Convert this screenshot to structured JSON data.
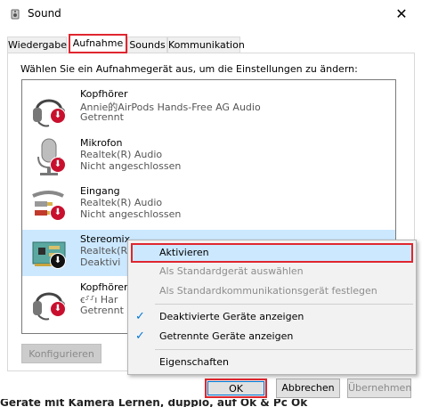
{
  "window": {
    "title": "Sound"
  },
  "tabs": [
    {
      "label": "Wiedergabe"
    },
    {
      "label": "Aufnahme"
    },
    {
      "label": "Sounds"
    },
    {
      "label": "Kommunikation"
    }
  ],
  "instruction": "Wählen Sie ein Aufnahmegerät aus, um die Einstellungen zu ändern:",
  "devices": [
    {
      "name": "Kopfhörer",
      "desc": "Annie的AirPods Hands-Free AG Audio",
      "state": "Getrennt",
      "icon": "headset-icon"
    },
    {
      "name": "Mikrofon",
      "desc": "Realtek(R) Audio",
      "state": "Nicht angeschlossen",
      "icon": "microphone-icon"
    },
    {
      "name": "Eingang",
      "desc": "Realtek(R) Audio",
      "state": "Nicht angeschlossen",
      "icon": "line-in-cable-icon"
    },
    {
      "name": "Stereomix",
      "desc": "Realtek(R)",
      "state": "Deaktivi",
      "icon": "circuit-board-icon"
    },
    {
      "name": "Kopfhörer",
      "desc": "ꞓ⸉⸉ı Har",
      "state": "Getrennt",
      "icon": "headset-icon"
    }
  ],
  "buttons": {
    "configure": "Konfigurieren",
    "ok": "OK",
    "cancel": "Abbrechen",
    "apply": "Übernehmen"
  },
  "context_menu": {
    "items": [
      {
        "label": "Aktivieren"
      },
      {
        "label": "Als Standardgerät auswählen"
      },
      {
        "label": "Als Standardkommunikationsgerät festlegen"
      },
      {
        "label": "Deaktivierte Geräte anzeigen"
      },
      {
        "label": "Getrennte Geräte anzeigen"
      },
      {
        "label": "Eigenschaften"
      }
    ]
  },
  "background_text": "Geräte mit Kamera Lernen, duppio, auf Ok & Pc Ok"
}
